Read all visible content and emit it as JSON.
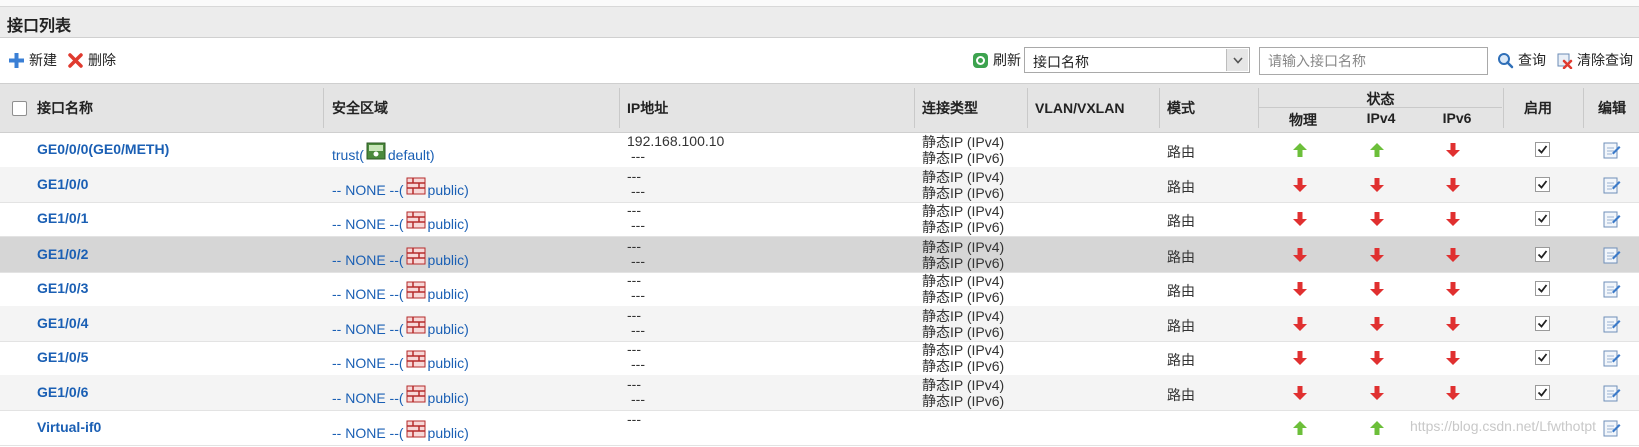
{
  "page": {
    "title": "接口列表"
  },
  "toolbar": {
    "new_label": "新建",
    "delete_label": "删除",
    "refresh_label": "刷新",
    "search_field_selected": "接口名称",
    "search_placeholder": "请输入接口名称",
    "query_label": "查询",
    "clear_query_label": "清除查询"
  },
  "table": {
    "headers": {
      "name": "接口名称",
      "zone": "安全区域",
      "ip": "IP地址",
      "conn_type": "连接类型",
      "vlan": "VLAN/VXLAN",
      "mode": "模式",
      "status": "状态",
      "physical": "物理",
      "ipv4": "IPv4",
      "ipv6": "IPv6",
      "enable": "启用",
      "edit": "编辑"
    },
    "rows": [
      {
        "name": "GE0/0/0(GE0/METH)",
        "zone_prefix": "trust(",
        "zone_suffix": "default)",
        "zone_icon": "trust-zone-icon",
        "ip1": "192.168.100.10",
        "ip2": "---",
        "ct1": "静态IP (IPv4)",
        "ct2": "静态IP (IPv6)",
        "mode": "路由",
        "phys": "up",
        "v4": "up",
        "v6": "down"
      },
      {
        "name": "GE1/0/0",
        "zone_prefix": "-- NONE --(",
        "zone_suffix": "public)",
        "zone_icon": "public-zone-icon",
        "ip1": "---",
        "ip2": "---",
        "ct1": "静态IP (IPv4)",
        "ct2": "静态IP (IPv6)",
        "mode": "路由",
        "phys": "down",
        "v4": "down",
        "v6": "down"
      },
      {
        "name": "GE1/0/1",
        "zone_prefix": "-- NONE --(",
        "zone_suffix": "public)",
        "zone_icon": "public-zone-icon",
        "ip1": "---",
        "ip2": "---",
        "ct1": "静态IP (IPv4)",
        "ct2": "静态IP (IPv6)",
        "mode": "路由",
        "phys": "down",
        "v4": "down",
        "v6": "down"
      },
      {
        "name": "GE1/0/2",
        "zone_prefix": "-- NONE --(",
        "zone_suffix": "public)",
        "zone_icon": "public-zone-icon",
        "ip1": "---",
        "ip2": "---",
        "ct1": "静态IP (IPv4)",
        "ct2": "静态IP (IPv6)",
        "mode": "路由",
        "phys": "down",
        "v4": "down",
        "v6": "down"
      },
      {
        "name": "GE1/0/3",
        "zone_prefix": "-- NONE --(",
        "zone_suffix": "public)",
        "zone_icon": "public-zone-icon",
        "ip1": "---",
        "ip2": "---",
        "ct1": "静态IP (IPv4)",
        "ct2": "静态IP (IPv6)",
        "mode": "路由",
        "phys": "down",
        "v4": "down",
        "v6": "down"
      },
      {
        "name": "GE1/0/4",
        "zone_prefix": "-- NONE --(",
        "zone_suffix": "public)",
        "zone_icon": "public-zone-icon",
        "ip1": "---",
        "ip2": "---",
        "ct1": "静态IP (IPv4)",
        "ct2": "静态IP (IPv6)",
        "mode": "路由",
        "phys": "down",
        "v4": "down",
        "v6": "down"
      },
      {
        "name": "GE1/0/5",
        "zone_prefix": "-- NONE --(",
        "zone_suffix": "public)",
        "zone_icon": "public-zone-icon",
        "ip1": "---",
        "ip2": "---",
        "ct1": "静态IP (IPv4)",
        "ct2": "静态IP (IPv6)",
        "mode": "路由",
        "phys": "down",
        "v4": "down",
        "v6": "down"
      },
      {
        "name": "GE1/0/6",
        "zone_prefix": "-- NONE --(",
        "zone_suffix": "public)",
        "zone_icon": "public-zone-icon",
        "ip1": "---",
        "ip2": "---",
        "ct1": "静态IP (IPv4)",
        "ct2": "静态IP (IPv6)",
        "mode": "路由",
        "phys": "down",
        "v4": "down",
        "v6": "down"
      },
      {
        "name": "Virtual-if0",
        "zone_prefix": "-- NONE --(",
        "zone_suffix": "public)",
        "zone_icon": "public-zone-icon",
        "ip1": "---",
        "ip2": "",
        "ct1": "",
        "ct2": "",
        "mode": "",
        "phys": "up",
        "v4": "up",
        "v6": ""
      }
    ]
  },
  "watermark": "https://blog.csdn.net/Lfwthotpt",
  "colors": {
    "link": "#1a5fb4",
    "up": "#6cbf3a",
    "down": "#e03030",
    "header_bg": "#e4e4e4",
    "selected_row": "#d6d6d6"
  }
}
